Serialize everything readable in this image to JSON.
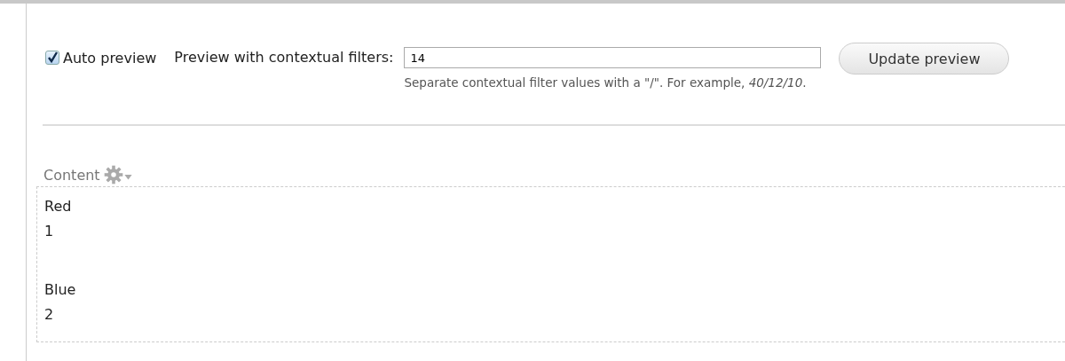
{
  "controls": {
    "auto_preview": {
      "label": "Auto preview",
      "checked": true
    },
    "contextual_filters": {
      "label": "Preview with contextual filters:",
      "value": "14",
      "help": "Separate contextual filter values with a \"/\". For example, *40/12/10*."
    },
    "update_button": "Update preview"
  },
  "preview": {
    "title": "Content",
    "rows": [
      {
        "label": "Red",
        "value": "1"
      },
      {
        "label": "Blue",
        "value": "2"
      }
    ]
  }
}
